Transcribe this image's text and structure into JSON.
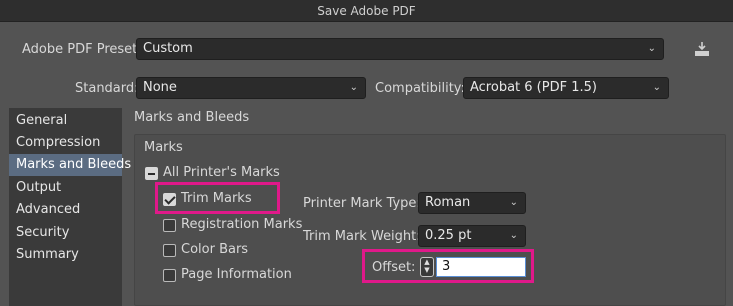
{
  "window": {
    "title": "Save Adobe PDF"
  },
  "preset": {
    "label": "Adobe PDF Preset:",
    "value": "Custom"
  },
  "standard": {
    "label": "Standard:",
    "value": "None"
  },
  "compatibility": {
    "label": "Compatibility:",
    "value": "Acrobat 6 (PDF 1.5)"
  },
  "icons": {
    "save_preset": "download-tray-icon",
    "chevron": "chevron-down-icon"
  },
  "sidebar": {
    "items": [
      {
        "label": "General"
      },
      {
        "label": "Compression"
      },
      {
        "label": "Marks and Bleeds",
        "selected": true
      },
      {
        "label": "Output"
      },
      {
        "label": "Advanced"
      },
      {
        "label": "Security"
      },
      {
        "label": "Summary"
      }
    ]
  },
  "main": {
    "section_title": "Marks and Bleeds",
    "marks_group_title": "Marks",
    "all_printers_marks": {
      "label": "All Printer's Marks",
      "state": "mixed"
    },
    "trim_marks": {
      "label": "Trim Marks",
      "checked": true
    },
    "registration_marks": {
      "label": "Registration Marks",
      "checked": false
    },
    "color_bars": {
      "label": "Color Bars",
      "checked": false
    },
    "page_information": {
      "label": "Page Information",
      "checked": false
    },
    "printer_mark_type": {
      "label": "Printer Mark Type:",
      "value": "Roman"
    },
    "trim_mark_weight": {
      "label": "Trim Mark Weight:",
      "value": "0.25 pt"
    },
    "offset": {
      "label": "Offset:",
      "value": "3"
    }
  },
  "colors": {
    "highlight": "#e0198a",
    "selection": "#5b6c82",
    "background": "#535353"
  }
}
